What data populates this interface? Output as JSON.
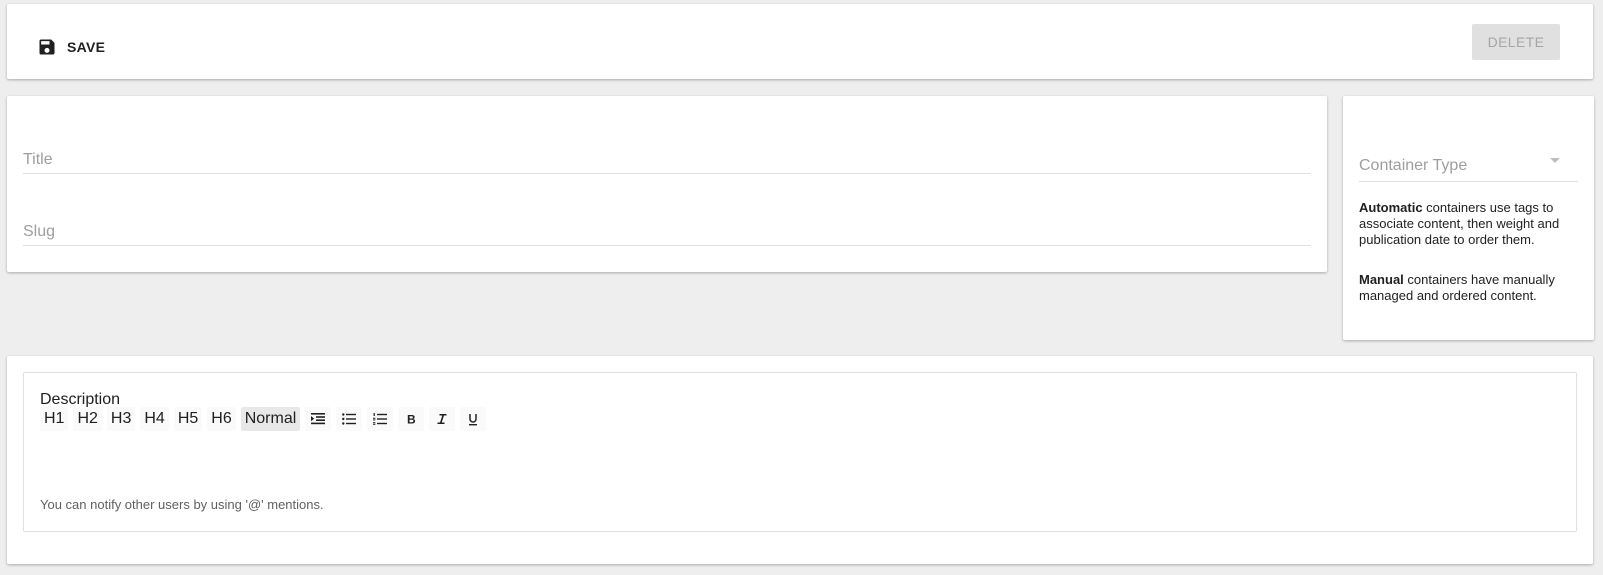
{
  "toolbar": {
    "save_label": "SAVE",
    "delete_label": "DELETE"
  },
  "main": {
    "title_placeholder": "Title",
    "slug_placeholder": "Slug"
  },
  "sidebar": {
    "container_type_placeholder": "Container Type",
    "help_automatic_bold": "Automatic",
    "help_automatic_text": " containers use tags to associate content, then weight and publication date to order them.",
    "help_manual_bold": "Manual",
    "help_manual_text": " containers have manually managed and ordered content."
  },
  "description": {
    "label": "Description",
    "toolbar": {
      "headings": [
        "H1",
        "H2",
        "H3",
        "H4",
        "H5",
        "H6"
      ],
      "normal": "Normal",
      "icons": [
        "indent-icon",
        "bullet-list-icon",
        "numbered-list-icon",
        "bold-icon",
        "italic-icon",
        "underline-icon"
      ]
    },
    "hint": "You can notify other users by using '@' mentions."
  },
  "colors": {
    "background": "#eeeeee",
    "card": "#ffffff",
    "delete_disabled_bg": "#e0e0e0",
    "delete_disabled_text": "#a6a6a6",
    "placeholder": "#9e9e9e"
  }
}
